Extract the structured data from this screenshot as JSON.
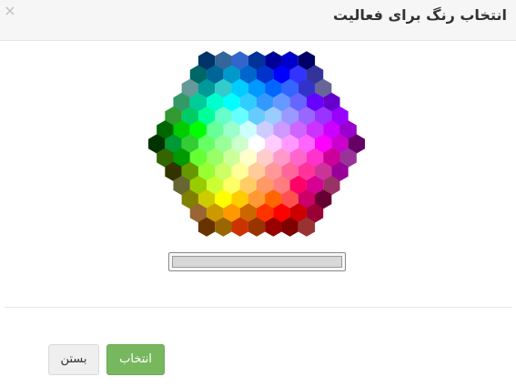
{
  "header": {
    "title": "انتخاب رنگ برای فعالیت",
    "close_symbol": "×"
  },
  "palette": {
    "rows": [
      [
        "#003366",
        "#336699",
        "#3366cc",
        "#003399",
        "#000099",
        "#0000cc",
        "#000066"
      ],
      [
        "#006666",
        "#006699",
        "#0099cc",
        "#0066cc",
        "#0033cc",
        "#0000ff",
        "#3333ff",
        "#333399"
      ],
      [
        "#669999",
        "#009999",
        "#33cccc",
        "#00ccff",
        "#0099ff",
        "#0066ff",
        "#3366ff",
        "#3333cc",
        "#666699"
      ],
      [
        "#339966",
        "#00cc99",
        "#00ffcc",
        "#00ffff",
        "#33ccff",
        "#3399ff",
        "#6699ff",
        "#6666ff",
        "#6600ff",
        "#6600cc"
      ],
      [
        "#339933",
        "#00cc66",
        "#00ff99",
        "#66ffcc",
        "#66ffff",
        "#66ccff",
        "#99ccff",
        "#9999ff",
        "#9966ff",
        "#9933ff",
        "#9900ff"
      ],
      [
        "#006600",
        "#00cc00",
        "#00ff00",
        "#66ff99",
        "#99ffcc",
        "#ccffff",
        "#ccccff",
        "#cc99ff",
        "#cc66ff",
        "#cc33ff",
        "#cc00ff",
        "#9900cc"
      ],
      [
        "#003300",
        "#009933",
        "#33cc33",
        "#66ff66",
        "#99ff99",
        "#ccffcc",
        "#ffffff",
        "#ffccff",
        "#ff99ff",
        "#ff66ff",
        "#ff00ff",
        "#cc00cc",
        "#660066"
      ],
      [
        "#336600",
        "#009900",
        "#66ff33",
        "#99ff66",
        "#ccff99",
        "#ffffcc",
        "#ffcccc",
        "#ff99cc",
        "#ff66cc",
        "#ff33cc",
        "#cc0099",
        "#993399"
      ],
      [
        "#333300",
        "#669900",
        "#99ff33",
        "#ccff66",
        "#ffff99",
        "#ffcc99",
        "#ff9999",
        "#ff6699",
        "#ff3399",
        "#cc3399",
        "#990099"
      ],
      [
        "#666633",
        "#99cc00",
        "#ccff33",
        "#ffff66",
        "#ffcc66",
        "#ff9966",
        "#ff7c80",
        "#ff0066",
        "#d60093",
        "#993366"
      ],
      [
        "#808000",
        "#cccc00",
        "#ffff00",
        "#ffcc00",
        "#ff9933",
        "#ff6600",
        "#ff5050",
        "#cc0066",
        "#660033"
      ],
      [
        "#996633",
        "#cc9900",
        "#ff9900",
        "#cc6600",
        "#ff3300",
        "#ff0000",
        "#cc0000",
        "#990033"
      ],
      [
        "#663300",
        "#996600",
        "#cc3300",
        "#993300",
        "#990000",
        "#800000",
        "#993333"
      ]
    ]
  },
  "color_field": {
    "value": "#d8d8d8"
  },
  "footer": {
    "select_label": "انتخاب",
    "close_label": "بستن",
    "select_color": "#77b85f"
  }
}
